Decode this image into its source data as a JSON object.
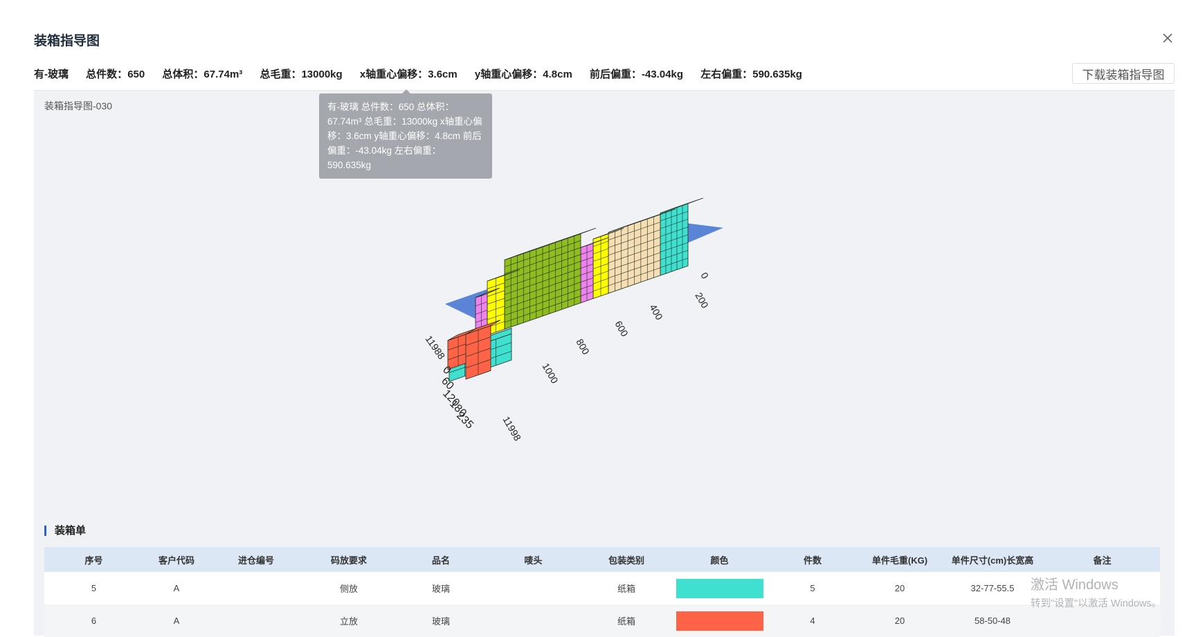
{
  "page": {
    "title": "装箱指导图",
    "download_label": "下载装箱指导图",
    "close_icon": "close-icon"
  },
  "stats": [
    {
      "label": "有-玻璃"
    },
    {
      "label": "总件数：",
      "value": "650"
    },
    {
      "label": "总体积：",
      "value": "67.74m³"
    },
    {
      "label": "总毛重：",
      "value": "13000kg"
    },
    {
      "label": "x轴重心偏移：",
      "value": "3.6cm"
    },
    {
      "label": "y轴重心偏移：",
      "value": "4.8cm"
    },
    {
      "label": "前后偏重：",
      "value": "-43.04kg"
    },
    {
      "label": "左右偏重：",
      "value": "590.635kg"
    }
  ],
  "viewer": {
    "title": "装箱指导图-030",
    "tooltip": "有-玻璃 总件数：650 总体积：67.74m³ 总毛重：13000kg x轴重心偏移：3.6cm y轴重心偏移：4.8cm 前后偏重：-43.04kg 左右偏重：590.635kg",
    "axis_length_labels": [
      "0",
      "200",
      "400",
      "600",
      "800",
      "1000",
      "11998"
    ],
    "axis_width_labels": [
      "0",
      "60",
      "120",
      "180",
      "235"
    ],
    "axis_corner_label": "11988",
    "colors": {
      "container": "#5b84d6",
      "teal": "#40e0d0",
      "tan": "#f5deb3",
      "yellow": "#ffff00",
      "magenta": "#ee82ee",
      "green": "#8fbc1f",
      "red": "#ff6347"
    }
  },
  "packing_list": {
    "section_title": "装箱单",
    "columns": [
      "序号",
      "客户代码",
      "进仓编号",
      "码放要求",
      "品名",
      "唛头",
      "包装类别",
      "颜色",
      "件数",
      "单件毛重(KG)",
      "单件尺寸(cm)长宽高",
      "备注"
    ],
    "rows": [
      {
        "no": "5",
        "customer": "A",
        "warehouse_no": "",
        "placement": "侧放",
        "name": "玻璃",
        "mark": "",
        "package": "纸箱",
        "color": "#40e0d0",
        "qty": "5",
        "weight": "20",
        "size": "32-77-55.5",
        "remark": ""
      },
      {
        "no": "6",
        "customer": "A",
        "warehouse_no": "",
        "placement": "立放",
        "name": "玻璃",
        "mark": "",
        "package": "纸箱",
        "color": "#ff6347",
        "qty": "4",
        "weight": "20",
        "size": "58-50-48",
        "remark": ""
      }
    ]
  },
  "watermark": {
    "line1": "激活 Windows",
    "line2": "转到\"设置\"以激活 Windows。"
  }
}
